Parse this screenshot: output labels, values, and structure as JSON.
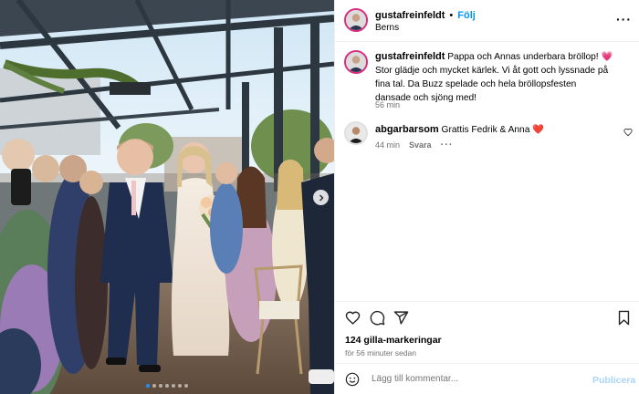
{
  "post": {
    "username": "gustafreinfeldt",
    "separator": "•",
    "follow_label": "Följ",
    "location": "Berns",
    "caption": "Pappa och Annas underbara bröllop! 💗 Stor glädje och mycket kärlek. Vi åt gott och lyssnade på fina tal. Da Buzz spelade och hela bröllopsfesten dansade och sjöng med!",
    "caption_time": "56 min"
  },
  "comments": [
    {
      "username": "abgarbarsom",
      "text": "Grattis Fedrik & Anna ❤️",
      "time": "44 min",
      "reply_label": "Svara"
    }
  ],
  "likes_text": "124 gilla-markeringar",
  "time_ago": "för 56 minuter sedan",
  "comment_box": {
    "placeholder": "Lägg till kommentar...",
    "publish_label": "Publicera"
  },
  "carousel": {
    "slide_count": 7,
    "active_slide": 1
  },
  "icons": {
    "more": "more-options-icon",
    "heart": "heart-icon",
    "comment": "comment-icon",
    "share": "share-icon",
    "save": "bookmark-icon",
    "emoji": "emoji-icon",
    "next": "chevron-right-icon"
  },
  "colors": {
    "accent": "#0095f6",
    "story_ring": "#d92d7f",
    "heart_red": "#e0245e",
    "publish_disabled": "#a8d5fb"
  }
}
